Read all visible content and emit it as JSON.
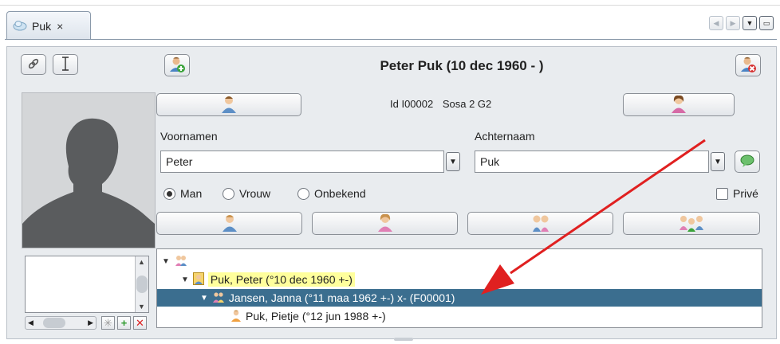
{
  "tab": {
    "title": "Puk",
    "close": "×"
  },
  "header": {
    "title": "Peter Puk (10 dec 1960 - )"
  },
  "ids": {
    "id": "Id I00002",
    "sosa": "Sosa 2 G2"
  },
  "fields": {
    "firstname_label": "Voornamen",
    "firstname_value": "Peter",
    "lastname_label": "Achternaam",
    "lastname_value": "Puk"
  },
  "sex": {
    "male": "Man",
    "female": "Vrouw",
    "unknown": "Onbekend",
    "selected": "Man"
  },
  "privacy": {
    "label": "Privé"
  },
  "tree": {
    "rows": [
      {
        "label": "Puk, Peter (°10 dec 1960 +-)"
      },
      {
        "label": "Jansen, Janna (°11 maa 1962 +-) x- (F00001)"
      },
      {
        "label": "Puk, Pietje (°12 jun 1988 +-)"
      }
    ]
  },
  "colors": {
    "selection": "#3b6e8f",
    "highlight": "#ffff9c",
    "arrow": "#e02020"
  }
}
